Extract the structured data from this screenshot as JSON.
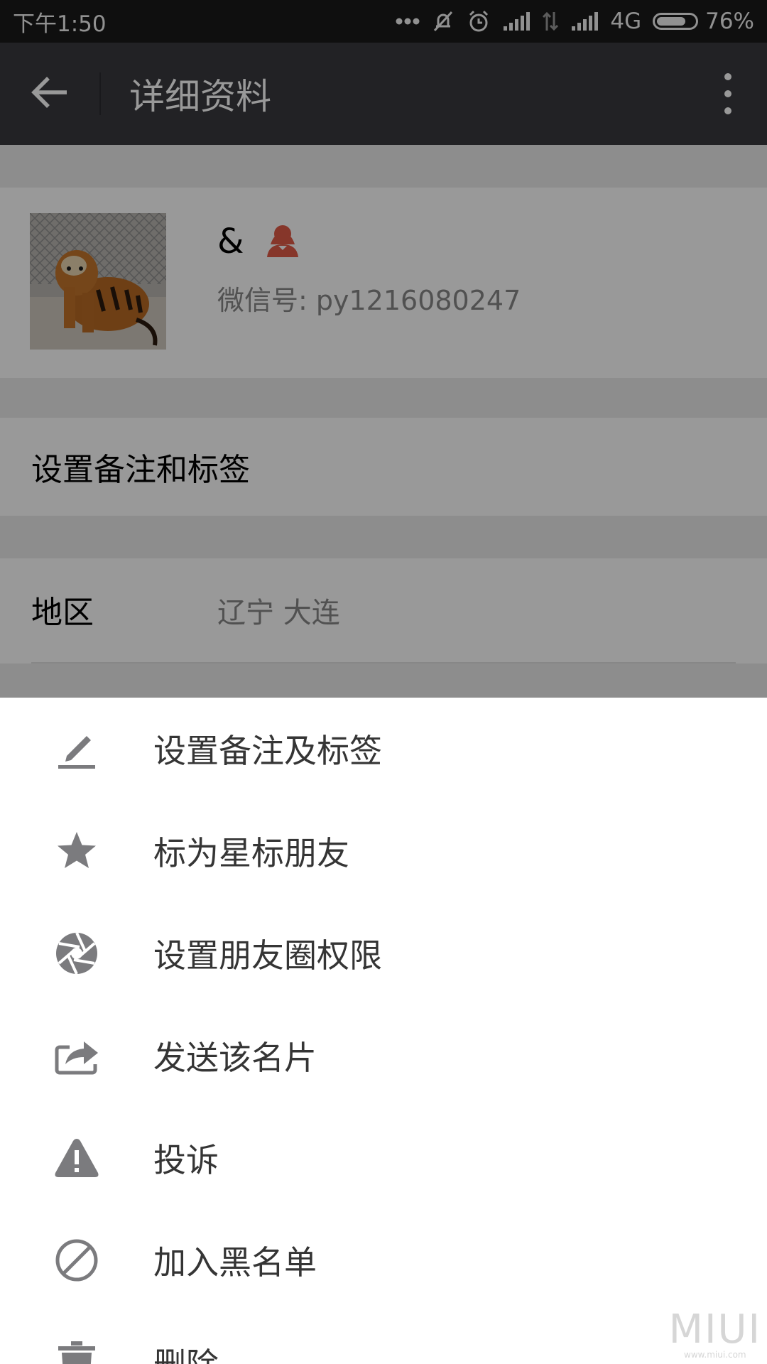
{
  "status_bar": {
    "time": "下午1:50",
    "network": "4G",
    "battery": "76%",
    "battery_level": 0.76
  },
  "title_bar": {
    "title": "详细资料",
    "back_icon": "arrow-left-icon",
    "more_icon": "more-vertical-icon"
  },
  "profile": {
    "nickname": "&",
    "gender_icon": "female-user-icon",
    "wechat_id": "微信号: py1216080247"
  },
  "remark_row": {
    "label": "设置备注和标签"
  },
  "region": {
    "label": "地区",
    "value": "辽宁  大连"
  },
  "menu": [
    {
      "label": "设置备注及标签",
      "icon": "pencil-icon"
    },
    {
      "label": "标为星标朋友",
      "icon": "star-icon"
    },
    {
      "label": "设置朋友圈权限",
      "icon": "aperture-icon"
    },
    {
      "label": "发送该名片",
      "icon": "share-icon"
    },
    {
      "label": "投诉",
      "icon": "warning-icon"
    },
    {
      "label": "加入黑名单",
      "icon": "block-icon"
    },
    {
      "label": "删除",
      "icon": "trash-icon"
    }
  ],
  "watermark": {
    "logo": "MIUI",
    "url": "www.miui.com"
  },
  "colors": {
    "title_bar": "#393a3f",
    "status_bar": "#1a1a1a",
    "sheet_icon": "#7b7b7e",
    "female_icon": "#e05a47"
  }
}
